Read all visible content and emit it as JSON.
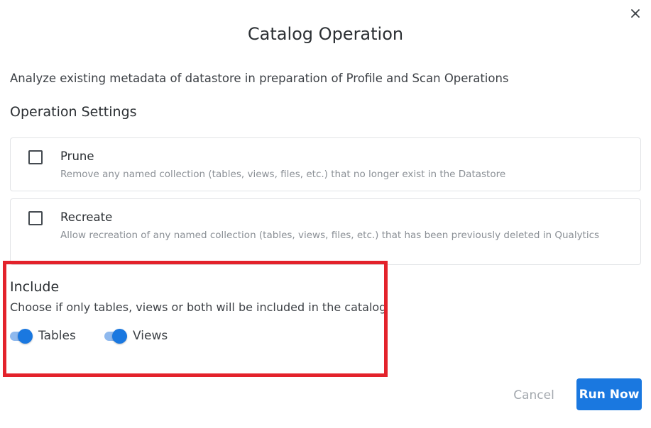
{
  "dialog": {
    "title": "Catalog Operation",
    "description": "Analyze existing metadata of datastore in preparation of Profile and Scan Operations",
    "close_icon": "close-icon"
  },
  "settings": {
    "title": "Operation Settings",
    "options": [
      {
        "label": "Prune",
        "description": "Remove any named collection (tables, views, files, etc.) that no longer exist in the Datastore",
        "checked": false
      },
      {
        "label": "Recreate",
        "description": "Allow recreation of any named collection (tables, views, files, etc.) that has been previously deleted in Qualytics",
        "checked": false
      }
    ]
  },
  "include": {
    "title": "Include",
    "description": "Choose if only tables, views or both will be included in the catalog",
    "toggles": [
      {
        "label": "Tables",
        "on": true
      },
      {
        "label": "Views",
        "on": true
      }
    ]
  },
  "actions": {
    "cancel_label": "Cancel",
    "run_label": "Run Now"
  },
  "colors": {
    "primary": "#1a78e0",
    "highlight": "#e3222b"
  }
}
